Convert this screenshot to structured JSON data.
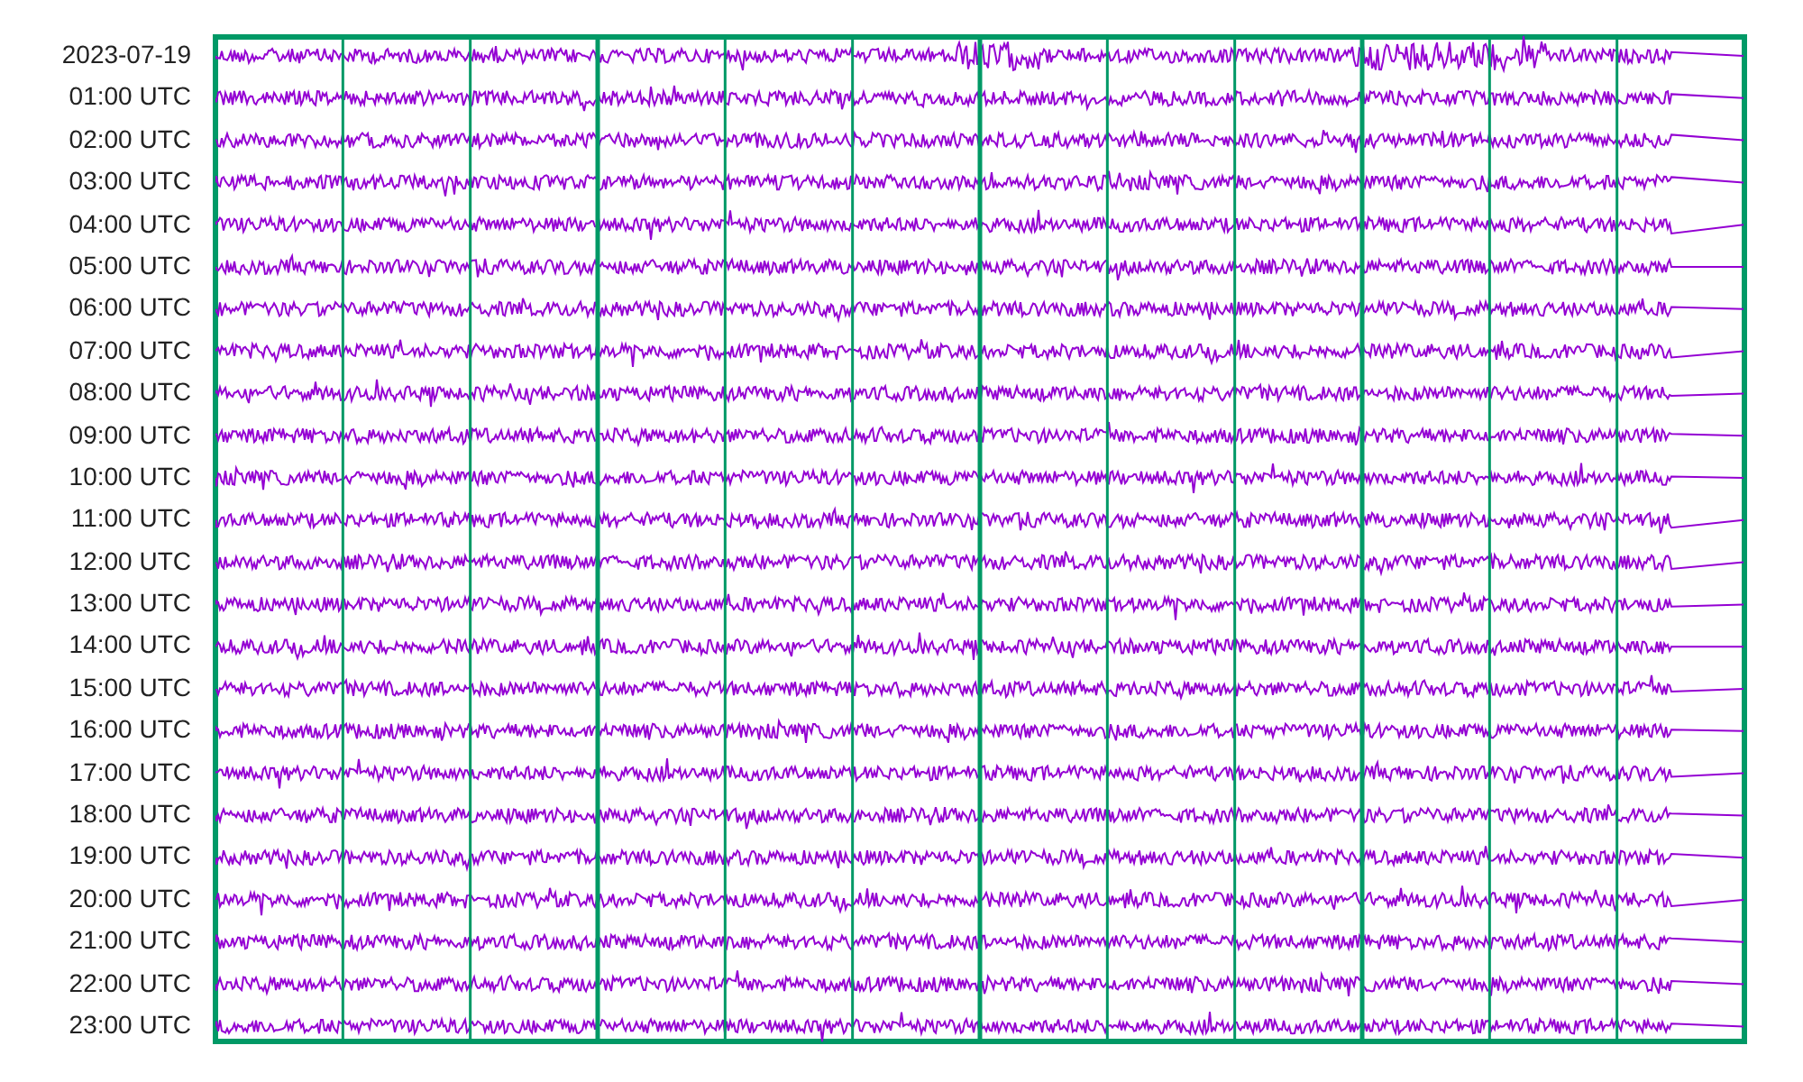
{
  "trace_labels": [
    "2023-07-19",
    "01:00 UTC",
    "02:00 UTC",
    "03:00 UTC",
    "04:00 UTC",
    "05:00 UTC",
    "06:00 UTC",
    "07:00 UTC",
    "08:00 UTC",
    "09:00 UTC",
    "10:00 UTC",
    "11:00 UTC",
    "12:00 UTC",
    "13:00 UTC",
    "14:00 UTC",
    "15:00 UTC",
    "16:00 UTC",
    "17:00 UTC",
    "18:00 UTC",
    "19:00 UTC",
    "20:00 UTC",
    "21:00 UTC",
    "22:00 UTC",
    "23:00 UTC"
  ]
}
